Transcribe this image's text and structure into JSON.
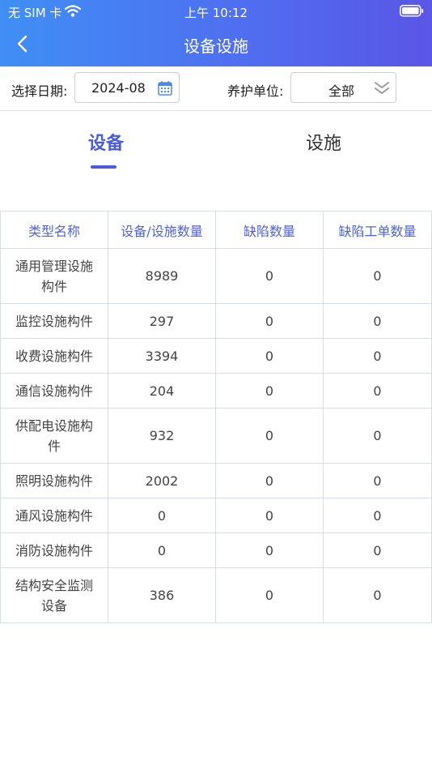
{
  "status_bar": {
    "carrier": "无 SIM 卡",
    "time": "上午 10:12"
  },
  "nav": {
    "title": "设备设施"
  },
  "filters": {
    "date_label": "选择日期:",
    "date_value": "2024-08",
    "unit_label": "养护单位:",
    "unit_value": "全部"
  },
  "tabs": [
    {
      "label": "设备",
      "active": true
    },
    {
      "label": "设施",
      "active": false
    }
  ],
  "table": {
    "headers": [
      "类型名称",
      "设备/设施数量",
      "缺陷数量",
      "缺陷工单数量"
    ],
    "rows": [
      {
        "name_lines": [
          "通用管理设施",
          "构件"
        ],
        "count": "8989",
        "defects": "0",
        "orders": "0"
      },
      {
        "name_lines": [
          "监控设施构件"
        ],
        "count": "297",
        "defects": "0",
        "orders": "0"
      },
      {
        "name_lines": [
          "收费设施构件"
        ],
        "count": "3394",
        "defects": "0",
        "orders": "0"
      },
      {
        "name_lines": [
          "通信设施构件"
        ],
        "count": "204",
        "defects": "0",
        "orders": "0"
      },
      {
        "name_lines": [
          "供配电设施构",
          "件"
        ],
        "count": "932",
        "defects": "0",
        "orders": "0"
      },
      {
        "name_lines": [
          "照明设施构件"
        ],
        "count": "2002",
        "defects": "0",
        "orders": "0"
      },
      {
        "name_lines": [
          "通风设施构件"
        ],
        "count": "0",
        "defects": "0",
        "orders": "0"
      },
      {
        "name_lines": [
          "消防设施构件"
        ],
        "count": "0",
        "defects": "0",
        "orders": "0"
      },
      {
        "name_lines": [
          "结构安全监测",
          "设备"
        ],
        "count": "386",
        "defects": "0",
        "orders": "0"
      }
    ]
  },
  "colors": {
    "accent": "#4a5bdc",
    "header_start": "#3f8ff5",
    "header_end": "#5a55e6"
  }
}
